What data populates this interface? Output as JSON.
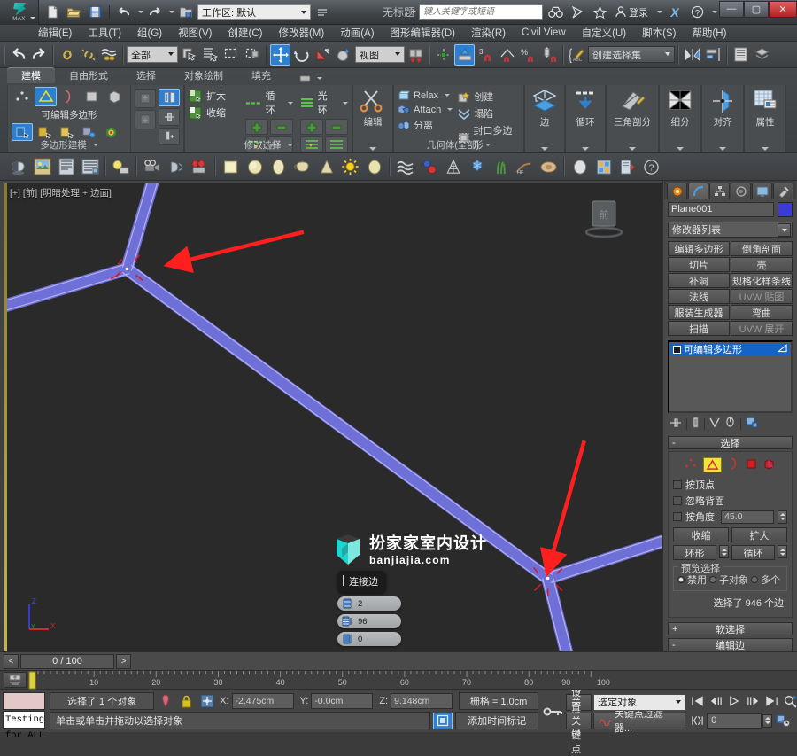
{
  "titlebar": {
    "app_logo": "3ds-max-logo",
    "logo_text": "MAX",
    "workspace_label": "工作区: 默认",
    "document_title": "无标题",
    "search_placeholder": "键入关键字或短语",
    "signin_label": "登录",
    "x_label": "X",
    "help_label": "?",
    "min_label": "—",
    "max_label": "▢",
    "close_label": "✕"
  },
  "menubar": {
    "items": [
      {
        "label": "编辑(E)"
      },
      {
        "label": "工具(T)"
      },
      {
        "label": "组(G)"
      },
      {
        "label": "视图(V)"
      },
      {
        "label": "创建(C)"
      },
      {
        "label": "修改器(M)"
      },
      {
        "label": "动画(A)"
      },
      {
        "label": "图形编辑器(D)"
      },
      {
        "label": "渲染(R)"
      },
      {
        "label": "Civil View"
      },
      {
        "label": "自定义(U)"
      },
      {
        "label": "脚本(S)"
      },
      {
        "label": "帮助(H)"
      }
    ]
  },
  "main_toolbar": {
    "selection_filter": "全部",
    "reference_coord": "视图",
    "named_selection_sets": "创建选择集"
  },
  "ribbon": {
    "tabs": [
      {
        "label": "建模",
        "active": true
      },
      {
        "label": "自由形式",
        "active": false
      },
      {
        "label": "选择",
        "active": false
      },
      {
        "label": "对象绘制",
        "active": false
      },
      {
        "label": "填充",
        "active": false
      }
    ],
    "panels": [
      {
        "title": "多边形建模",
        "subtitle": "可编辑多边形"
      },
      {
        "title": "修改选择",
        "grow_label": "扩大",
        "shrink_label": "收缩",
        "ring_label": "循环",
        "loop_label": "光环"
      },
      {
        "title": "",
        "edit_label": "编辑"
      },
      {
        "title": "几何体(全部)",
        "items": [
          "Relax",
          "创建",
          "Attach",
          "塌陷",
          "分离",
          "封口多边形"
        ]
      },
      {
        "title": "",
        "label": "边"
      },
      {
        "title": "",
        "label": "循环"
      },
      {
        "title": "",
        "label": "三角剖分"
      },
      {
        "title": "",
        "label": "细分"
      },
      {
        "title": "",
        "label": "对齐"
      },
      {
        "title": "",
        "label": "属性"
      }
    ]
  },
  "viewport": {
    "label": "[+] [前] [明暗处理 + 边面]",
    "background": "#2b2b2b",
    "edge_color": "#6f6fd8",
    "selected_edge_color": "#d11a2a",
    "axis": {
      "z": "Z",
      "y": "Y",
      "x": "X"
    },
    "viewcube_label": "前",
    "watermark": {
      "title": "扮家家室内设计",
      "url": "banjiajia.com"
    },
    "caddy": {
      "title": "连接边",
      "fields": [
        {
          "icon": "segments-icon",
          "value": "2"
        },
        {
          "icon": "pinch-icon",
          "value": "96"
        },
        {
          "icon": "slide-icon",
          "value": "0"
        }
      ],
      "buttons": [
        {
          "name": "ok-button",
          "glyph": "✓",
          "color": "#2e8b2e"
        },
        {
          "name": "apply-button",
          "glyph": "+",
          "color": "#2e8b2e"
        },
        {
          "name": "cancel-button",
          "glyph": "✕",
          "color": "#cc2b2b"
        }
      ]
    }
  },
  "command_panel": {
    "tabs": [
      "create-tab",
      "modify-tab",
      "hierarchy-tab",
      "motion-tab",
      "display-tab",
      "utilities-tab"
    ],
    "active_tab_index": 1,
    "object_name": "Plane001",
    "object_color": "#3b3bd8",
    "modifier_list_label": "修改器列表",
    "modifier_buttons": [
      "编辑多边形",
      "倒角剖面",
      "切片",
      "壳",
      "补洞",
      "规格化样条线",
      "法线",
      "UVW 贴图",
      "服装生成器",
      "弯曲",
      "扫描",
      "UVW 展开"
    ],
    "stack": [
      {
        "label": "可编辑多边形",
        "selected": true
      }
    ],
    "rollouts": {
      "selection": {
        "title": "选择",
        "sub_levels": [
          "vertex-icon",
          "edge-icon",
          "border-icon",
          "polygon-icon",
          "element-icon"
        ],
        "active_sub_level": 1,
        "by_vertex": "按顶点",
        "ignore_backfacing": "忽略背面",
        "by_angle": "按角度:",
        "by_angle_value": "45.0",
        "shrink": "收缩",
        "grow": "扩大",
        "ring": "环形",
        "loop": "循环",
        "preview_group": "预览选择",
        "preview_options": [
          "禁用",
          "子对象",
          "多个"
        ],
        "preview_selected_index": 0,
        "status": "选择了 946 个边"
      },
      "soft_selection": {
        "title": "软选择",
        "expanded": false,
        "sign": "+"
      },
      "edit_edges": {
        "title": "编辑边",
        "expanded": true,
        "sign": "-"
      }
    }
  },
  "timeline": {
    "frame_field": "0 / 100",
    "prev_label": "<",
    "next_label": ">",
    "ticks": [
      "10",
      "20",
      "30",
      "40",
      "50",
      "60",
      "70",
      "80",
      "90",
      "100"
    ]
  },
  "status_bar": {
    "listener_text": "Testing for ALL",
    "selection_status": "选择了 1 个对象",
    "coord_x_label": "X:",
    "coord_x": "-2.475cm",
    "coord_y_label": "Y:",
    "coord_y": "-0.0cm",
    "coord_z_label": "Z:",
    "coord_z": "9.148cm",
    "grid_label": "栅格 = 1.0cm",
    "prompt": "单击或单击并拖动以选择对象",
    "add_time_tag": "添加时间标记",
    "auto_key": "自动关键点",
    "set_key": "设置关键点",
    "key_filter": "关键点过滤器...",
    "key_mode_value": "选定对象",
    "current_frame": "0"
  }
}
